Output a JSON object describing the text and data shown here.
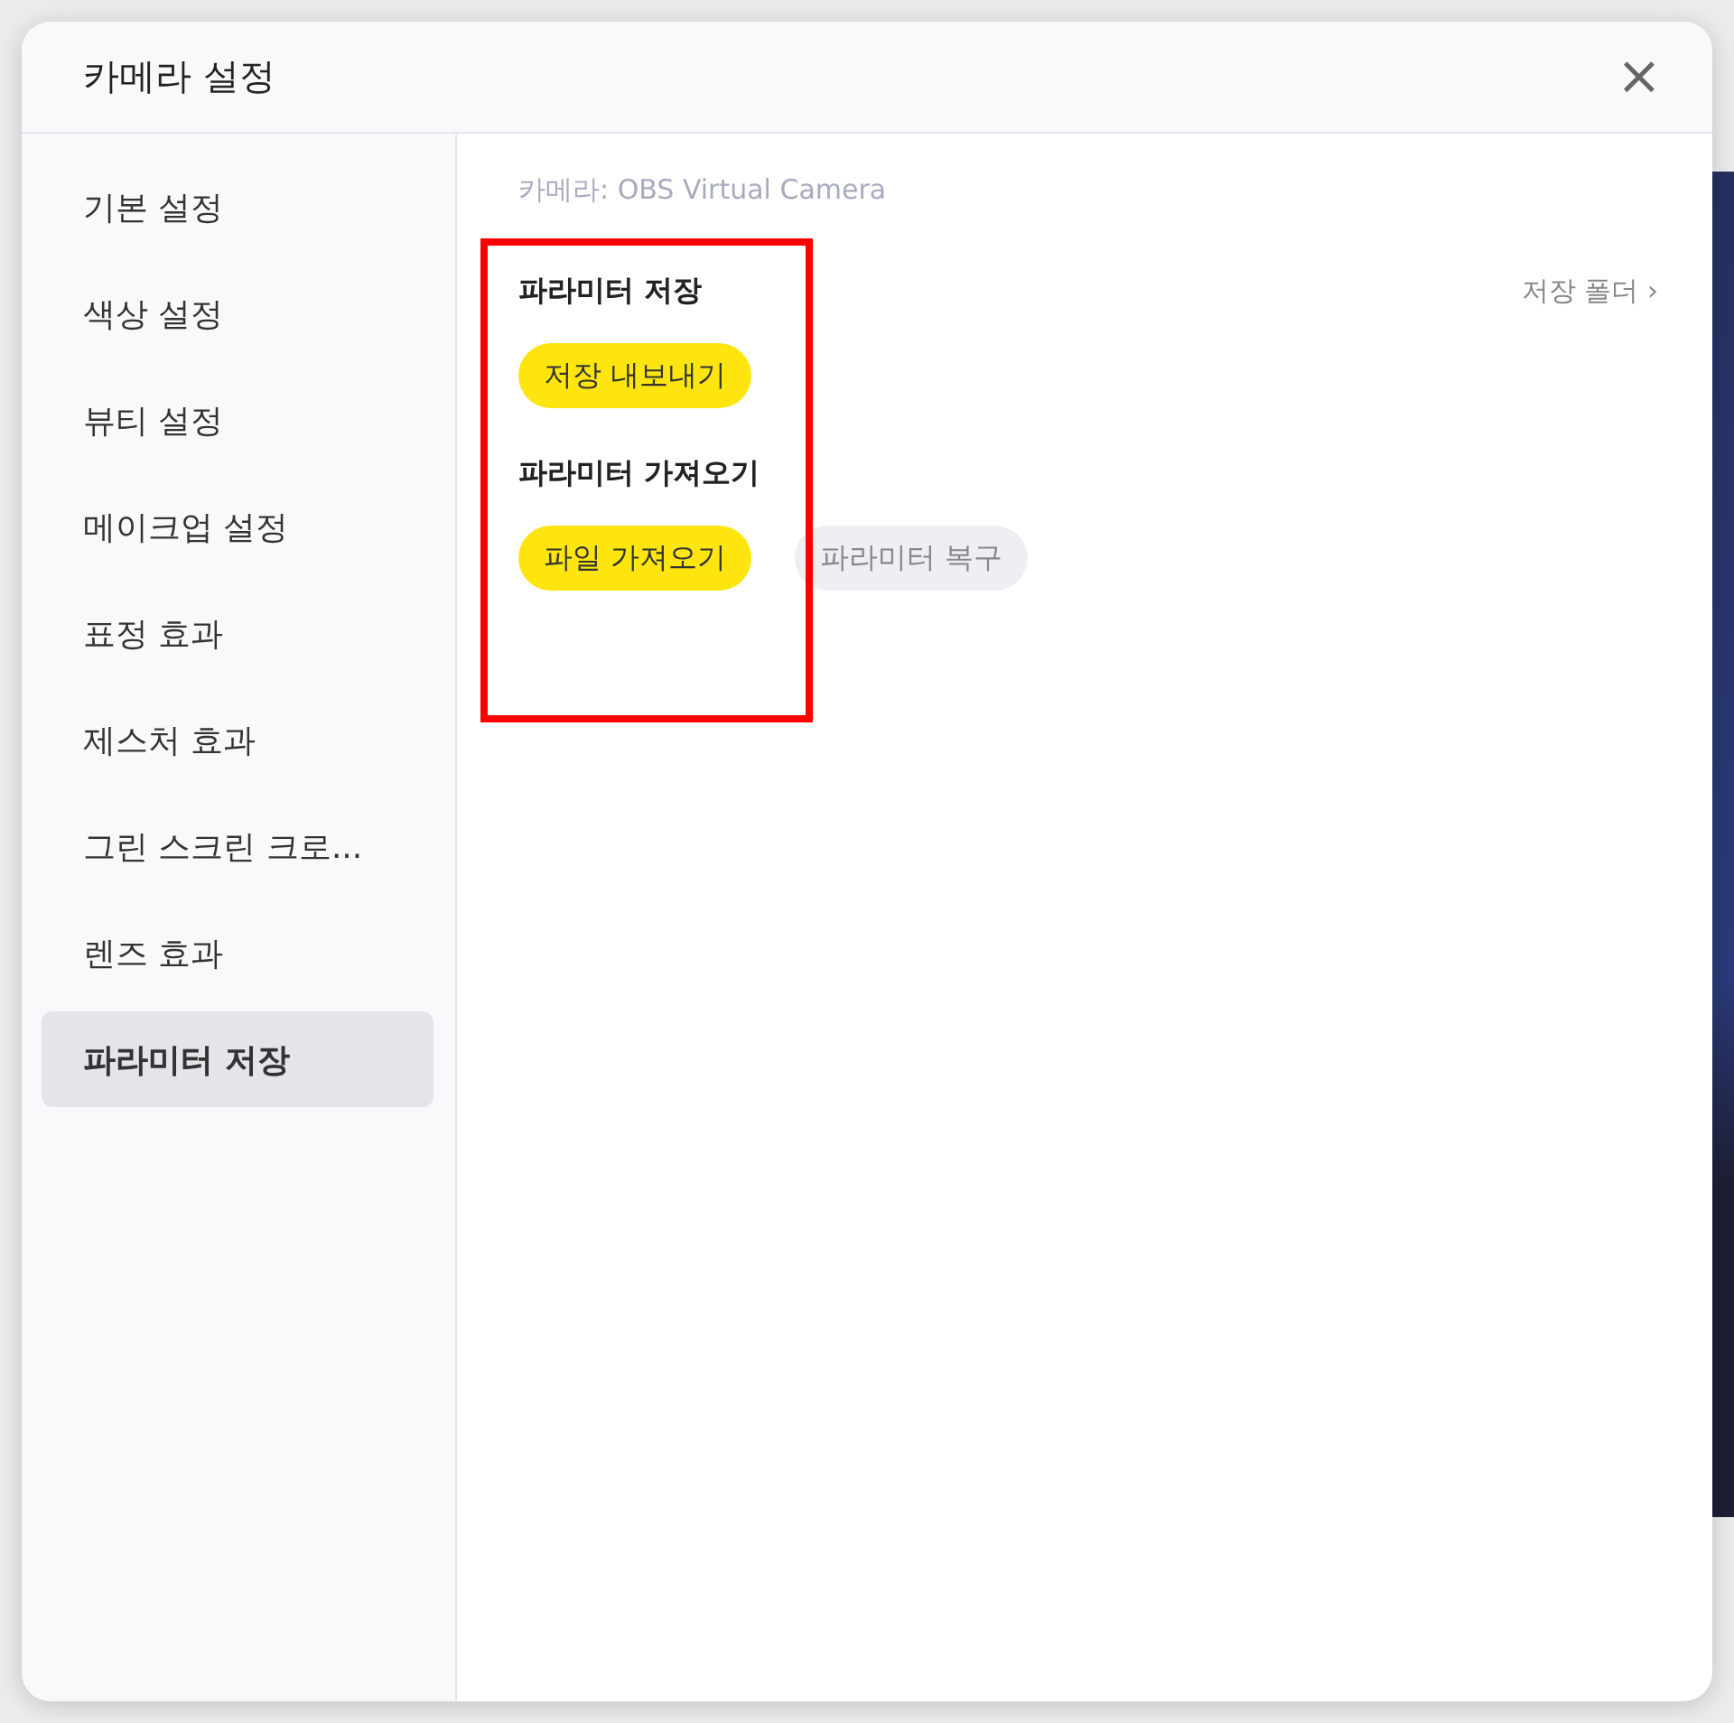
{
  "dialog": {
    "title": "카메라 설정",
    "close": "×",
    "sidebar": {
      "items": [
        {
          "label": "기본 설정",
          "selected": false
        },
        {
          "label": "색상 설정",
          "selected": false
        },
        {
          "label": "뷰티 설정",
          "selected": false
        },
        {
          "label": "메이크업 설정",
          "selected": false
        },
        {
          "label": "표정 효과",
          "selected": false
        },
        {
          "label": "제스처 효과",
          "selected": false
        },
        {
          "label": "그린 스크린 크로...",
          "selected": false
        },
        {
          "label": "렌즈 효과",
          "selected": false
        },
        {
          "label": "파라미터 저장",
          "selected": true
        }
      ]
    },
    "camera_label": "카메라:  OBS Virtual Camera",
    "sections": [
      {
        "title": "파라미터 저장",
        "link": "저장 폴더 ›",
        "buttons": [
          {
            "label": "저장 내보내기",
            "kind": "primary"
          }
        ]
      },
      {
        "title": "파라미터 가져오기",
        "buttons": [
          {
            "label": "파일 가져오기",
            "kind": "primary"
          },
          {
            "label": "파라미터 복구",
            "kind": "secondary"
          }
        ]
      }
    ],
    "annotation": {
      "kind": "frame"
    }
  }
}
